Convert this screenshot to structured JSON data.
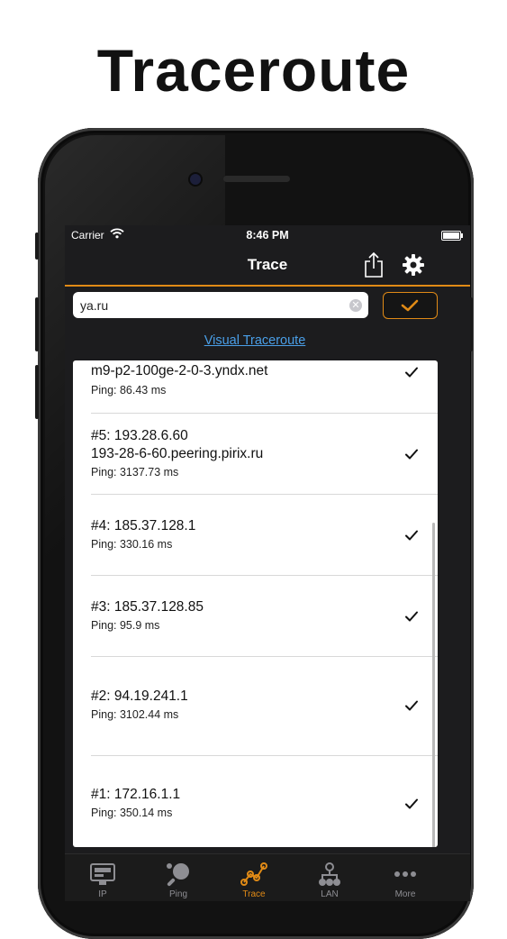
{
  "headline": "Traceroute",
  "status_bar": {
    "carrier": "Carrier",
    "time": "8:46 PM"
  },
  "nav": {
    "title": "Trace"
  },
  "search": {
    "value": "ya.ru"
  },
  "visual_link": "Visual Traceroute",
  "hops": [
    {
      "line1": "m9-p2-100ge-2-0-3.yndx.net",
      "line2": "",
      "ping": "Ping: 86.43 ms",
      "status": "checkmark"
    },
    {
      "line1": "#5: 193.28.6.60",
      "line2": "193-28-6-60.peering.pirix.ru",
      "ping": "Ping: 3137.73 ms",
      "status": "checkmark"
    },
    {
      "line1": "#4: 185.37.128.1",
      "line2": "",
      "ping": "Ping: 330.16 ms",
      "status": "checkmark"
    },
    {
      "line1": "#3: 185.37.128.85",
      "line2": "",
      "ping": "Ping: 95.9 ms",
      "status": "checkmark"
    },
    {
      "line1": "#2: 94.19.241.1",
      "line2": "",
      "ping": "Ping: 3102.44 ms",
      "status": "checkmark"
    },
    {
      "line1": "#1: 172.16.1.1",
      "line2": "",
      "ping": "Ping: 350.14 ms",
      "status": "checkmark"
    }
  ],
  "tabs": [
    {
      "label": "IP",
      "icon": "monitor-icon"
    },
    {
      "label": "Ping",
      "icon": "ping-pong-icon"
    },
    {
      "label": "Trace",
      "icon": "trace-icon",
      "active": true
    },
    {
      "label": "LAN",
      "icon": "lan-icon"
    },
    {
      "label": "More",
      "icon": "more-icon"
    }
  ],
  "colors": {
    "accent": "#e08a16",
    "link": "#4a9fe8",
    "screen_bg": "#1c1c1e"
  }
}
